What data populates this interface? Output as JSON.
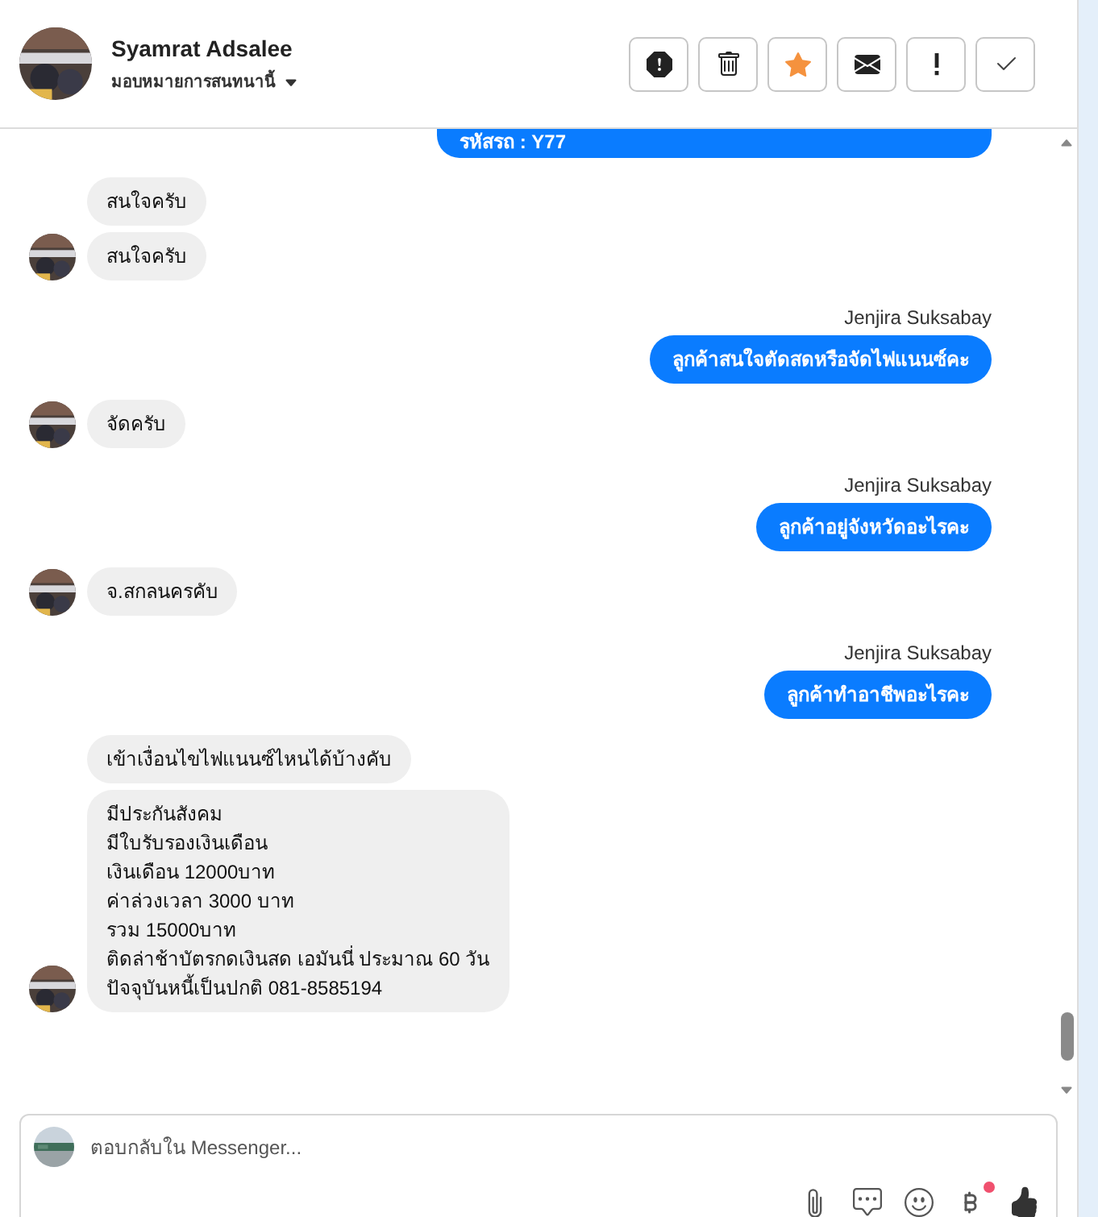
{
  "header": {
    "name": "Syamrat Adsalee",
    "assign_label": "มอบหมายการสนทนานี้",
    "actions": [
      {
        "kind": "report"
      },
      {
        "kind": "delete"
      },
      {
        "kind": "star",
        "on": true
      },
      {
        "kind": "mail"
      },
      {
        "kind": "important"
      },
      {
        "kind": "done"
      }
    ]
  },
  "messages": [
    {
      "kind": "outgoing",
      "text": "รหัสรถ : Y77"
    },
    {
      "kind": "incoming",
      "text": "สนใจครับ",
      "show_avatar": false
    },
    {
      "kind": "incoming",
      "text": "สนใจครับ",
      "show_avatar": true
    },
    {
      "kind": "outgoing",
      "sender": "Jenjira Suksabay",
      "text": "ลูกค้าสนใจตัดสดหรือจัดไฟแนนซ์คะ"
    },
    {
      "kind": "incoming",
      "text": "จัดครับ",
      "show_avatar": true
    },
    {
      "kind": "outgoing",
      "sender": "Jenjira Suksabay",
      "text": "ลูกค้าอยู่จังหวัดอะไรคะ"
    },
    {
      "kind": "incoming",
      "text": "จ.สกลนครคับ",
      "show_avatar": true
    },
    {
      "kind": "outgoing",
      "sender": "Jenjira Suksabay",
      "text": "ลูกค้าทำอาชีพอะไรคะ"
    },
    {
      "kind": "incoming",
      "text": "เข้าเงื่อนไขไฟแนนซ์ไหนได้บ้างคับ",
      "show_avatar": false
    },
    {
      "kind": "incoming",
      "text": "มีประกันสังคม\nมีใบรับรองเงินเดือน\nเงินเดือน 12000บาท\nค่าล่วงเวลา 3000 บาท\nรวม 15000บาท\nติดล่าช้าบัตรกดเงินสด เอมันนี่ ประมาณ 60 วัน\nปัจจุบันหนี้เป็นปกติ 081-8585194",
      "show_avatar": true
    }
  ],
  "composer": {
    "placeholder": "ตอบกลับใน Messenger...",
    "tools": [
      {
        "kind": "attach"
      },
      {
        "kind": "saved-reply"
      },
      {
        "kind": "emoji"
      },
      {
        "kind": "payment",
        "badge": true
      },
      {
        "kind": "like"
      }
    ]
  }
}
